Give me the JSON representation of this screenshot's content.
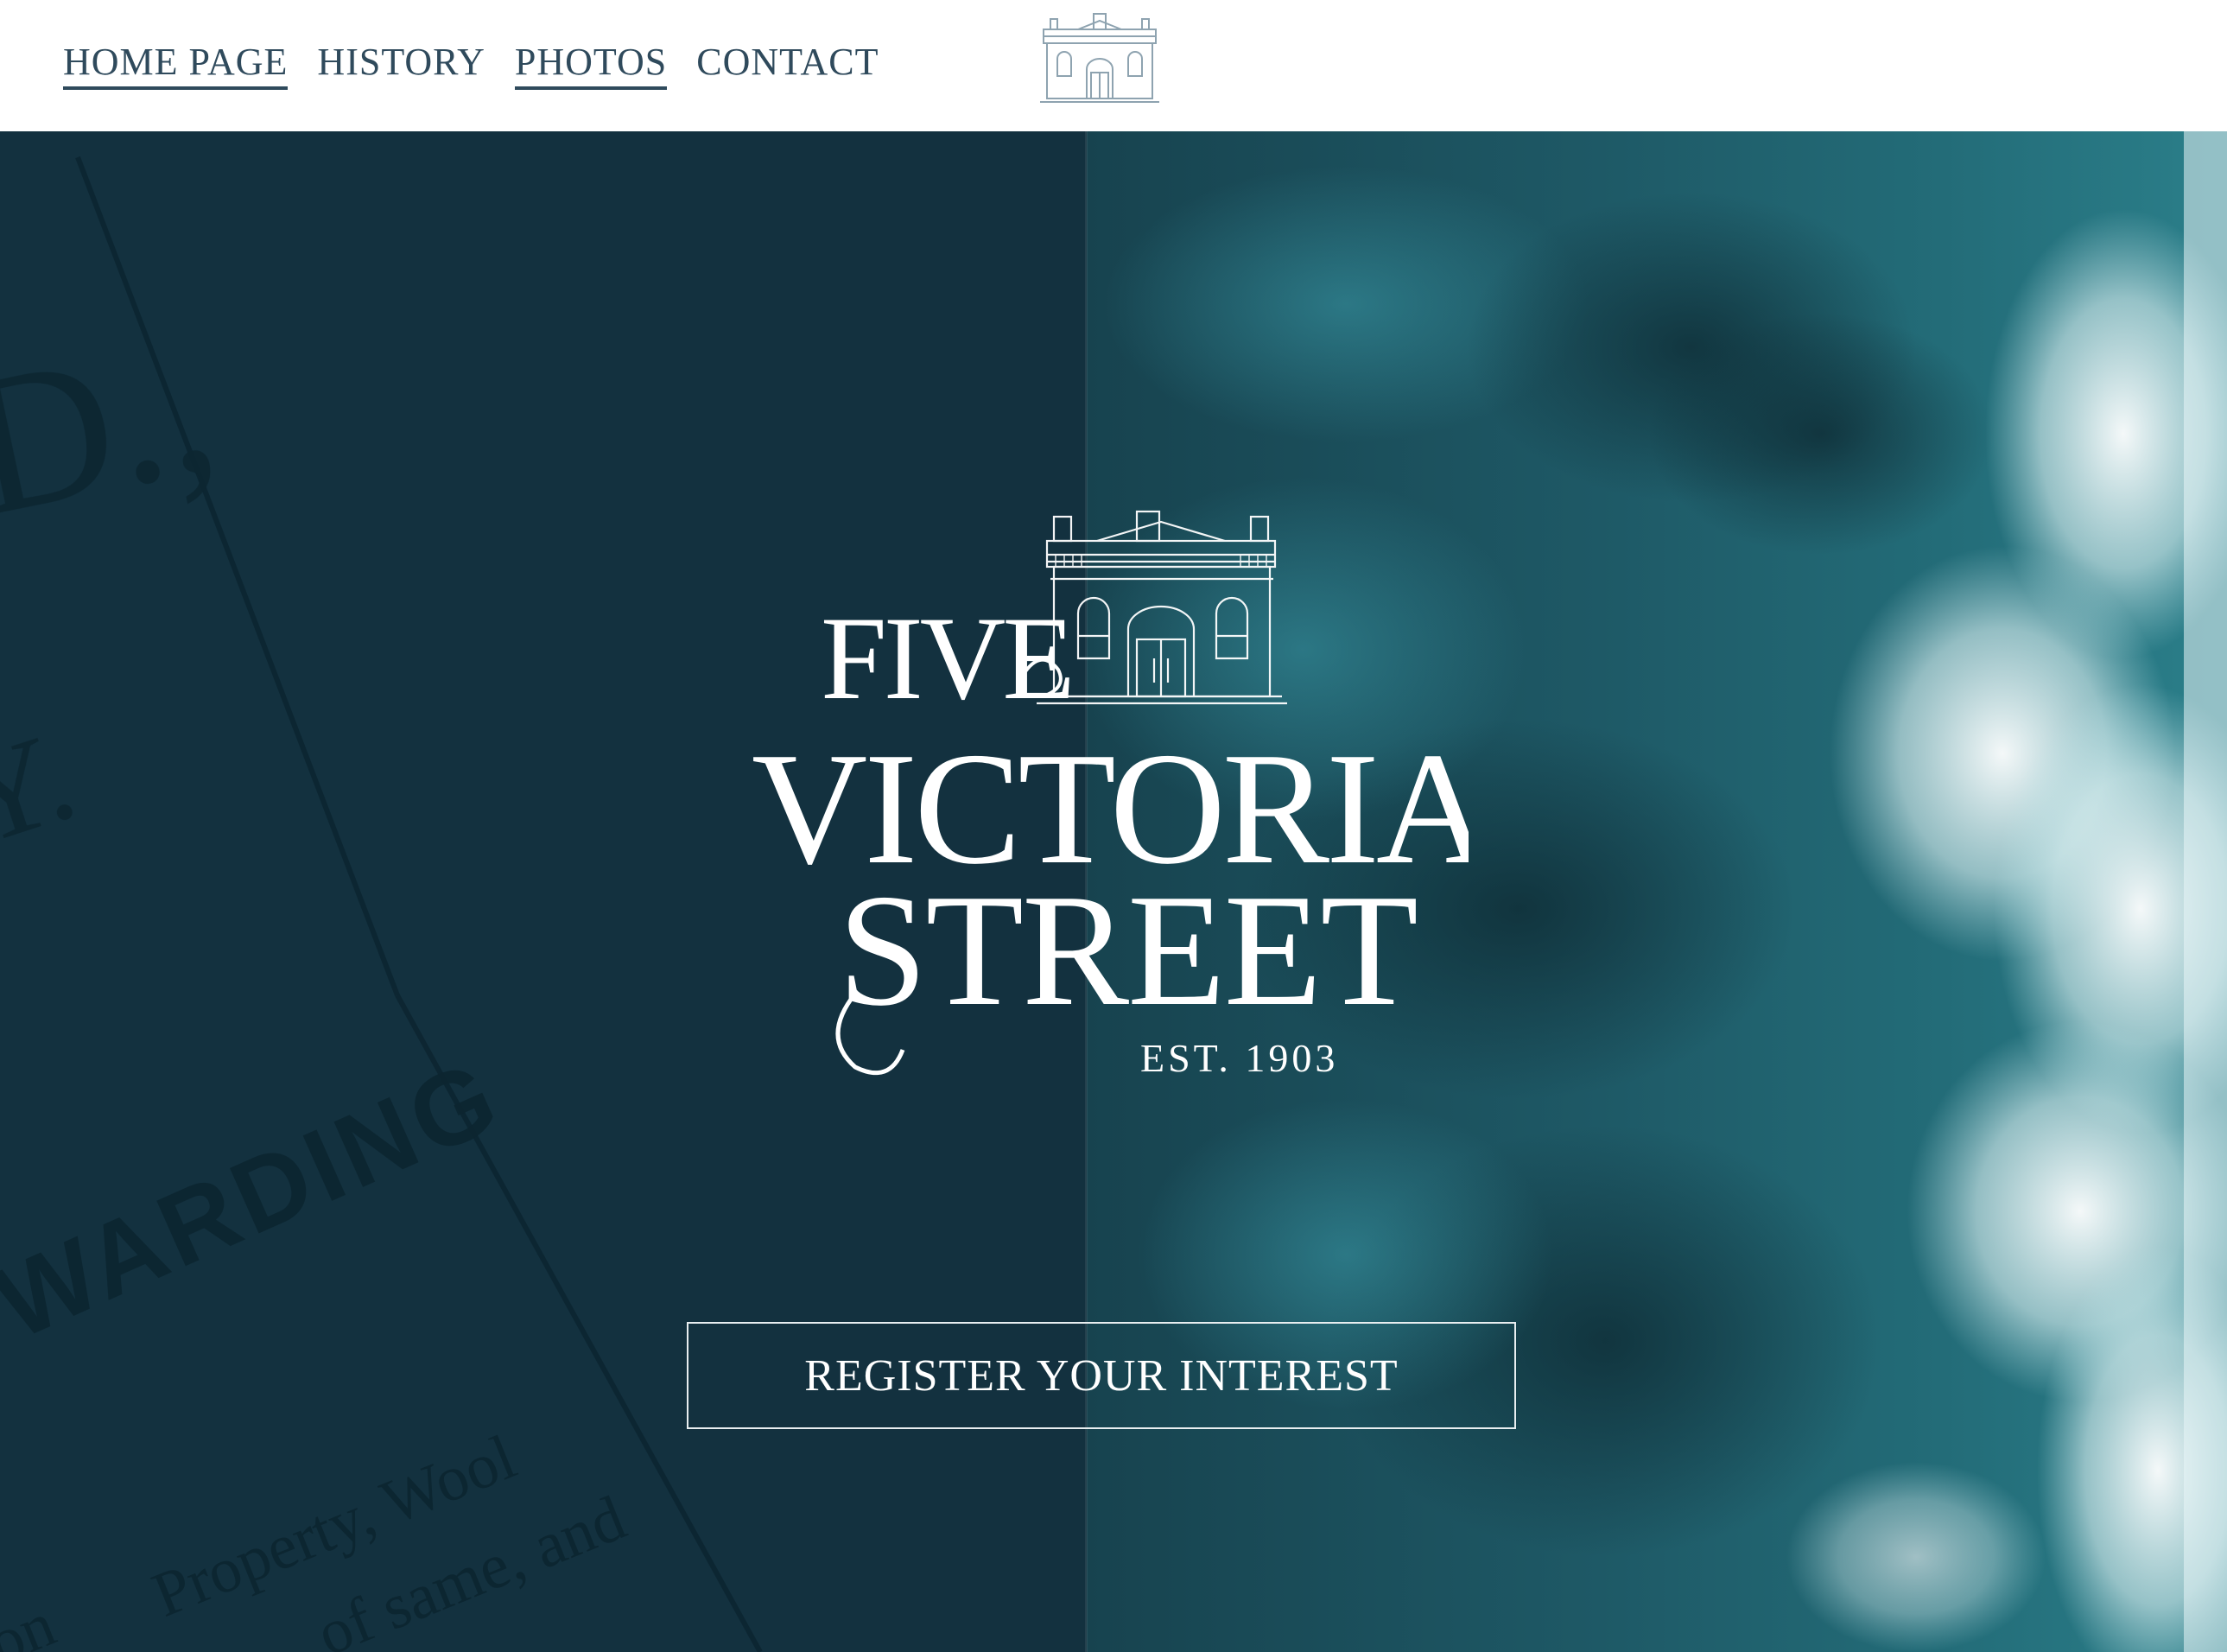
{
  "nav": {
    "items": [
      {
        "label": "HOME PAGE",
        "active": true
      },
      {
        "label": "HISTORY",
        "active": false
      },
      {
        "label": "PHOTOS",
        "active": true
      },
      {
        "label": "CONTACT",
        "active": false
      }
    ]
  },
  "hero": {
    "logo": {
      "line1": "FIVE",
      "line2": "VICTORIA",
      "line3": "STREET",
      "established": "EST. 1903"
    },
    "background_text": {
      "large_word": "WARDING",
      "fragment_top": "D.,",
      "fragment_mid": "Y.",
      "lines": [
        "Property, Wool",
        "of same, and",
        "on"
      ]
    },
    "cta_label": "REGISTER YOUR INTEREST"
  },
  "colors": {
    "nav_text": "#2f4a5c",
    "hero_dark": "#13313f",
    "ocean": "#1f5f6c",
    "foam": "#ffffff",
    "logo_white": "#ffffff"
  },
  "icons": {
    "header_logo": "building-icon",
    "hero_building": "building-icon"
  }
}
